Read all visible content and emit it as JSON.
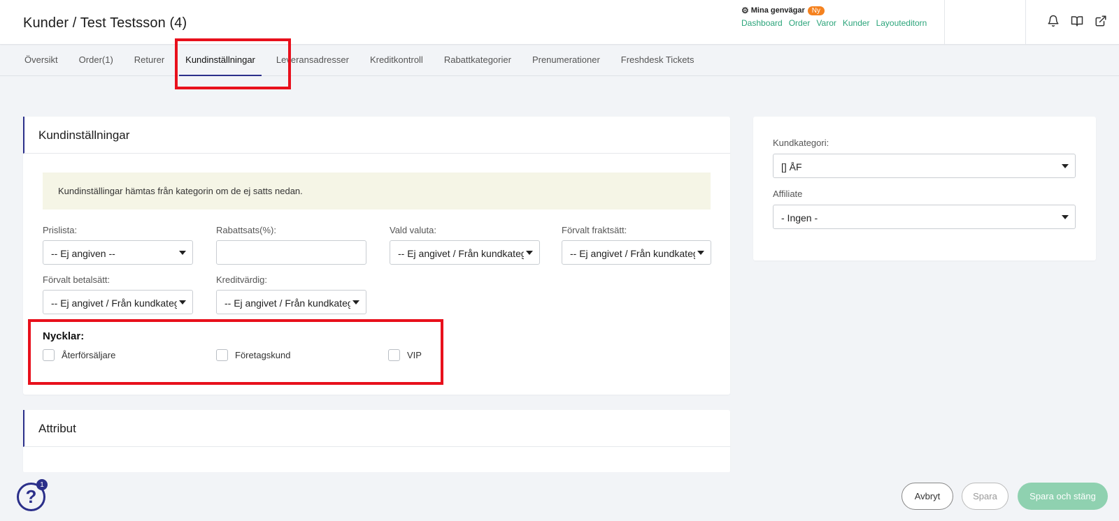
{
  "header": {
    "title": "Kunder / Test Testsson (4)",
    "shortcuts": {
      "label": "Mina genvägar",
      "badge": "Ny",
      "links": [
        "Dashboard",
        "Order",
        "Varor",
        "Kunder",
        "Layouteditorn"
      ]
    },
    "icons": [
      "bell-icon",
      "book-icon",
      "external-link-icon"
    ]
  },
  "tabs": [
    {
      "label": "Översikt",
      "active": false
    },
    {
      "label": "Order(1)",
      "active": false
    },
    {
      "label": "Returer",
      "active": false
    },
    {
      "label": "Kundinställningar",
      "active": true
    },
    {
      "label": "Leveransadresser",
      "active": false
    },
    {
      "label": "Kreditkontroll",
      "active": false
    },
    {
      "label": "Rabattkategorier",
      "active": false
    },
    {
      "label": "Prenumerationer",
      "active": false
    },
    {
      "label": "Freshdesk Tickets",
      "active": false
    }
  ],
  "settings": {
    "title": "Kundinställningar",
    "notice": "Kundinställingar hämtas från kategorin om de ej satts nedan.",
    "fields": {
      "pricelist": {
        "label": "Prislista:",
        "value": "-- Ej angiven --"
      },
      "discount": {
        "label": "Rabattsats(%):",
        "value": ""
      },
      "currency": {
        "label": "Vald valuta:",
        "value": "-- Ej angivet / Från kundkategori --"
      },
      "shipping": {
        "label": "Förvalt fraktsätt:",
        "value": "-- Ej angivet / Från kundkategori --"
      },
      "payment": {
        "label": "Förvalt betalsätt:",
        "value": "-- Ej angivet / Från kundkategori --"
      },
      "credit": {
        "label": "Kreditvärdig:",
        "value": "-- Ej angivet / Från kundkategori --"
      }
    },
    "keys": {
      "title": "Nycklar:",
      "items": [
        {
          "label": "Återförsäljare",
          "checked": false
        },
        {
          "label": "Företagskund",
          "checked": false
        },
        {
          "label": "VIP",
          "checked": false
        }
      ]
    }
  },
  "attributes": {
    "title": "Attribut"
  },
  "side": {
    "category": {
      "label": "Kundkategori:",
      "value": "[] ÅF"
    },
    "affiliate": {
      "label": "Affiliate",
      "value": "- Ingen -"
    }
  },
  "footer": {
    "help_badge": "1",
    "cancel": "Avbryt",
    "save": "Spara",
    "save_close": "Spara och stäng"
  },
  "colors": {
    "accent": "#2b2f8a",
    "link": "#2ba47a",
    "highlight": "#e8101c",
    "primary_button": "#8fd1b0",
    "badge": "#f5821f"
  }
}
